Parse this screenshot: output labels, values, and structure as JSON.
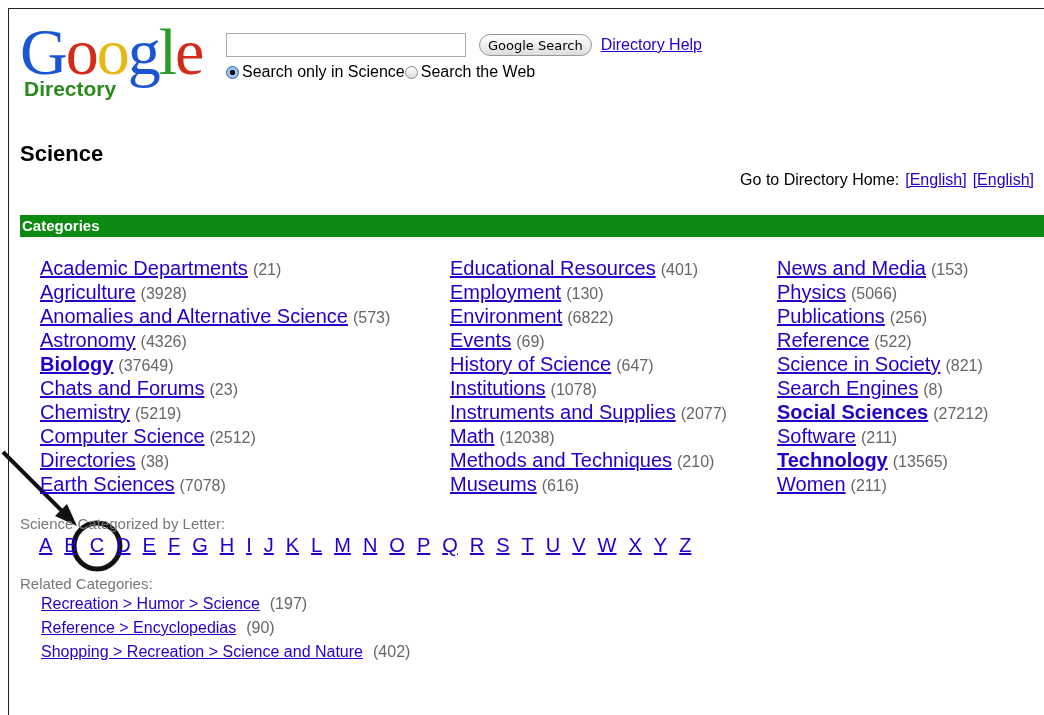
{
  "logo": {
    "wordmark": "Google",
    "subtitle": "Directory"
  },
  "search": {
    "button": "Google Search",
    "help_link": "Directory Help",
    "scopes": [
      {
        "label": "Search only in Science",
        "selected": true
      },
      {
        "label": "Search the Web",
        "selected": false
      }
    ]
  },
  "heading": "Science",
  "home": {
    "label": "Go to Directory Home:",
    "links": [
      "[English]",
      "[English]"
    ]
  },
  "categories": {
    "title": "Categories",
    "columns": [
      [
        {
          "name": "Academic Departments",
          "count": "(21)",
          "bold": false
        },
        {
          "name": "Agriculture",
          "count": "(3928)",
          "bold": false
        },
        {
          "name": "Anomalies and Alternative Science",
          "count": "(573)",
          "bold": false
        },
        {
          "name": "Astronomy",
          "count": "(4326)",
          "bold": false
        },
        {
          "name": "Biology",
          "count": "(37649)",
          "bold": true
        },
        {
          "name": "Chats and Forums",
          "count": "(23)",
          "bold": false
        },
        {
          "name": "Chemistry",
          "count": "(5219)",
          "bold": false
        },
        {
          "name": "Computer Science",
          "count": "(2512)",
          "bold": false
        },
        {
          "name": "Directories",
          "count": "(38)",
          "bold": false
        },
        {
          "name": "Earth Sciences",
          "count": "(7078)",
          "bold": false
        }
      ],
      [
        {
          "name": "Educational Resources",
          "count": "(401)",
          "bold": false
        },
        {
          "name": "Employment",
          "count": "(130)",
          "bold": false
        },
        {
          "name": "Environment",
          "count": "(6822)",
          "bold": false
        },
        {
          "name": "Events",
          "count": "(69)",
          "bold": false
        },
        {
          "name": "History of Science",
          "count": "(647)",
          "bold": false
        },
        {
          "name": "Institutions",
          "count": "(1078)",
          "bold": false
        },
        {
          "name": "Instruments and Supplies",
          "count": "(2077)",
          "bold": false
        },
        {
          "name": "Math",
          "count": "(12038)",
          "bold": false
        },
        {
          "name": "Methods and Techniques",
          "count": "(210)",
          "bold": false
        },
        {
          "name": "Museums",
          "count": "(616)",
          "bold": false
        }
      ],
      [
        {
          "name": "News and Media",
          "count": "(153)",
          "bold": false
        },
        {
          "name": "Physics",
          "count": "(5066)",
          "bold": false
        },
        {
          "name": "Publications",
          "count": "(256)",
          "bold": false
        },
        {
          "name": "Reference",
          "count": "(522)",
          "bold": false
        },
        {
          "name": "Science in Society",
          "count": "(821)",
          "bold": false
        },
        {
          "name": "Search Engines",
          "count": "(8)",
          "bold": false
        },
        {
          "name": "Social Sciences",
          "count": "(27212)",
          "bold": true
        },
        {
          "name": "Software",
          "count": "(211)",
          "bold": false
        },
        {
          "name": "Technology",
          "count": "(13565)",
          "bold": true
        },
        {
          "name": "Women",
          "count": "(211)",
          "bold": false
        }
      ]
    ]
  },
  "by_letter": {
    "label": "Science Categorized by Letter:",
    "letters": [
      {
        "label": "A",
        "circled": false
      },
      {
        "label": "B",
        "circled": false
      },
      {
        "label": "C",
        "circled": true
      },
      {
        "label": "D",
        "circled": false
      },
      {
        "label": "E",
        "circled": false
      },
      {
        "label": "F",
        "circled": false
      },
      {
        "label": "G",
        "circled": false
      },
      {
        "label": "H",
        "circled": false
      },
      {
        "label": "I",
        "circled": false
      },
      {
        "label": "J",
        "circled": false
      },
      {
        "label": "K",
        "circled": false
      },
      {
        "label": "L",
        "circled": false
      },
      {
        "label": "M",
        "circled": false
      },
      {
        "label": "N",
        "circled": false
      },
      {
        "label": "O",
        "circled": false
      },
      {
        "label": "P",
        "circled": false
      },
      {
        "label": "Q",
        "circled": false
      },
      {
        "label": "R",
        "circled": false
      },
      {
        "label": "S",
        "circled": false
      },
      {
        "label": "T",
        "circled": false
      },
      {
        "label": "U",
        "circled": false
      },
      {
        "label": "V",
        "circled": false
      },
      {
        "label": "W",
        "circled": false
      },
      {
        "label": "X",
        "circled": false
      },
      {
        "label": "Y",
        "circled": false
      },
      {
        "label": "Z",
        "circled": false
      }
    ]
  },
  "related": {
    "label": "Related Categories:",
    "items": [
      {
        "path": "Recreation > Humor > Science",
        "count": "(197)"
      },
      {
        "path": "Reference > Encyclopedias",
        "count": "(90)"
      },
      {
        "path": "Shopping > Recreation > Science and Nature",
        "count": "(402)"
      }
    ]
  }
}
